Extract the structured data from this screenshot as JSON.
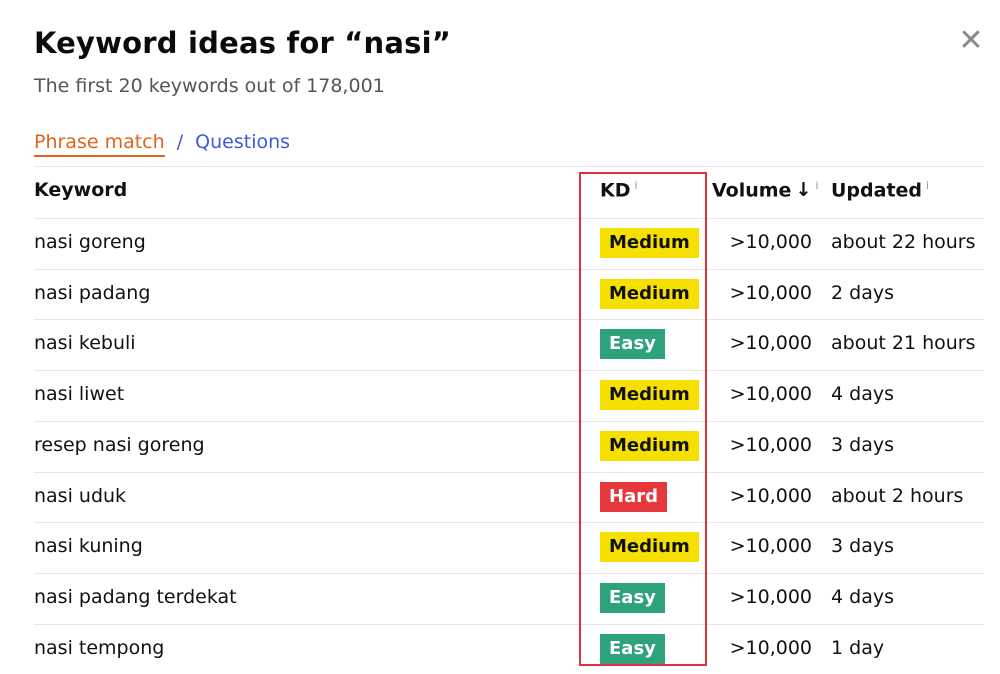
{
  "title": "Keyword ideas for “nasi”",
  "subtitle": "The first 20 keywords out of 178,001",
  "close_icon": "close-icon",
  "tabs": {
    "phrase_match": "Phrase match",
    "separator": "/",
    "questions": "Questions"
  },
  "columns": {
    "keyword": "Keyword",
    "kd": "KD",
    "volume": "Volume",
    "updated": "Updated",
    "info_icon": "i",
    "sort_arrow": "↓"
  },
  "colors": {
    "accent_orange": "#e0651a",
    "link_blue": "#3d5bd6",
    "medium": "#f5e000",
    "easy": "#2ea27a",
    "hard": "#e5383b",
    "highlight": "#e0303a"
  },
  "rows": [
    {
      "keyword": "nasi goreng",
      "kd": "Medium",
      "volume": ">10,000",
      "updated": "about 22 hours"
    },
    {
      "keyword": "nasi padang",
      "kd": "Medium",
      "volume": ">10,000",
      "updated": "2 days"
    },
    {
      "keyword": "nasi kebuli",
      "kd": "Easy",
      "volume": ">10,000",
      "updated": "about 21 hours"
    },
    {
      "keyword": "nasi liwet",
      "kd": "Medium",
      "volume": ">10,000",
      "updated": "4 days"
    },
    {
      "keyword": "resep nasi goreng",
      "kd": "Medium",
      "volume": ">10,000",
      "updated": "3 days"
    },
    {
      "keyword": "nasi uduk",
      "kd": "Hard",
      "volume": ">10,000",
      "updated": "about 2 hours"
    },
    {
      "keyword": "nasi kuning",
      "kd": "Medium",
      "volume": ">10,000",
      "updated": "3 days"
    },
    {
      "keyword": "nasi padang terdekat",
      "kd": "Easy",
      "volume": ">10,000",
      "updated": "4 days"
    },
    {
      "keyword": "nasi tempong",
      "kd": "Easy",
      "volume": ">10,000",
      "updated": "1 day"
    }
  ]
}
